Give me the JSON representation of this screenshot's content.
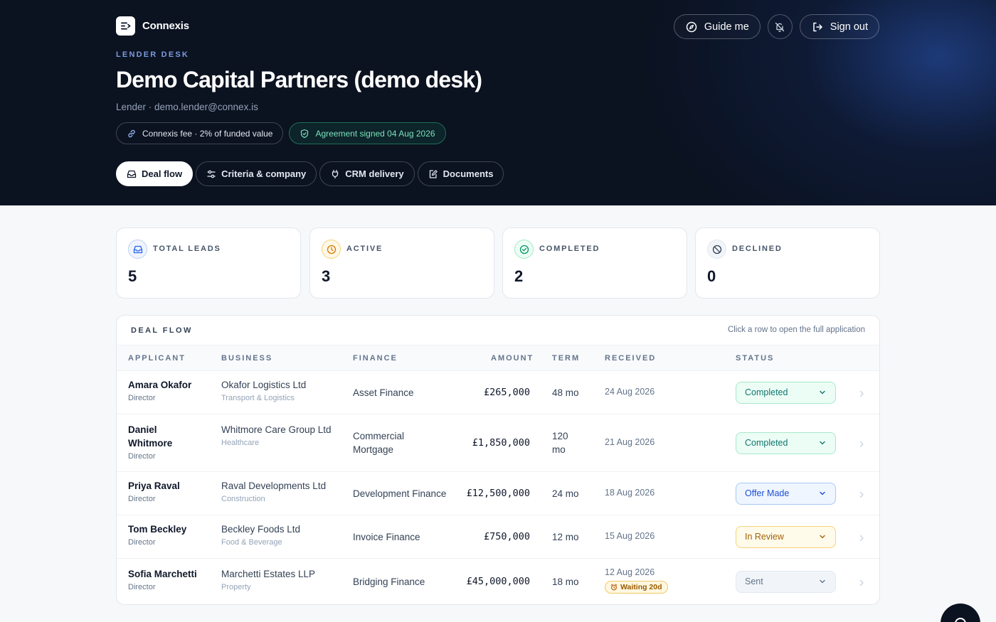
{
  "brand": {
    "name": "Connexis"
  },
  "top_actions": {
    "guide_label": "Guide me",
    "signout_label": "Sign out"
  },
  "hero": {
    "eyebrow": "LENDER DESK",
    "title": "Demo Capital Partners (demo desk)",
    "subtitle": "Lender · demo.lender@connex.is",
    "fee_chip": "Connexis fee · 2% of funded value",
    "agreement_chip": "Agreement signed 04 Aug 2026"
  },
  "tabs": [
    {
      "label": "Deal flow",
      "icon": "inbox-icon",
      "active": true
    },
    {
      "label": "Criteria & company",
      "icon": "sliders-icon",
      "active": false
    },
    {
      "label": "CRM delivery",
      "icon": "plug-icon",
      "active": false
    },
    {
      "label": "Documents",
      "icon": "document-edit-icon",
      "active": false
    }
  ],
  "stats": [
    {
      "label": "TOTAL LEADS",
      "value": "5",
      "icon": "inbox-icon",
      "color": "#2563eb"
    },
    {
      "label": "ACTIVE",
      "value": "3",
      "icon": "clock-icon",
      "color": "#d97706"
    },
    {
      "label": "COMPLETED",
      "value": "2",
      "icon": "check-circle-icon",
      "color": "#059669"
    },
    {
      "label": "DECLINED",
      "value": "0",
      "icon": "ban-icon",
      "color": "#475569"
    }
  ],
  "deal_flow": {
    "title": "DEAL FLOW",
    "hint": "Click a row to open the full application",
    "columns": [
      "APPLICANT",
      "BUSINESS",
      "FINANCE",
      "AMOUNT",
      "TERM",
      "RECEIVED",
      "STATUS"
    ],
    "rows": [
      {
        "applicant": "Amara Okafor",
        "role": "Director",
        "business": "Okafor Logistics Ltd",
        "sector": "Transport & Logistics",
        "finance": "Asset Finance",
        "amount": "£265,000",
        "term": "48 mo",
        "received": "24 Aug 2026",
        "waiting": "",
        "status": "Completed",
        "status_kind": "completed"
      },
      {
        "applicant": "Daniel Whitmore",
        "role": "Director",
        "business": "Whitmore Care Group Ltd",
        "sector": "Healthcare",
        "finance": "Commercial Mortgage",
        "amount": "£1,850,000",
        "term": "120 mo",
        "received": "21 Aug 2026",
        "waiting": "",
        "status": "Completed",
        "status_kind": "completed"
      },
      {
        "applicant": "Priya Raval",
        "role": "Director",
        "business": "Raval Developments Ltd",
        "sector": "Construction",
        "finance": "Development Finance",
        "amount": "£12,500,000",
        "term": "24 mo",
        "received": "18 Aug 2026",
        "waiting": "",
        "status": "Offer Made",
        "status_kind": "offer"
      },
      {
        "applicant": "Tom Beckley",
        "role": "Director",
        "business": "Beckley Foods Ltd",
        "sector": "Food & Beverage",
        "finance": "Invoice Finance",
        "amount": "£750,000",
        "term": "12 mo",
        "received": "15 Aug 2026",
        "waiting": "",
        "status": "In Review",
        "status_kind": "review"
      },
      {
        "applicant": "Sofia Marchetti",
        "role": "Director",
        "business": "Marchetti Estates LLP",
        "sector": "Property",
        "finance": "Bridging Finance",
        "amount": "£45,000,000",
        "term": "18 mo",
        "received": "12 Aug 2026",
        "waiting": "Waiting 20d",
        "status": "Sent",
        "status_kind": "sent"
      }
    ]
  }
}
